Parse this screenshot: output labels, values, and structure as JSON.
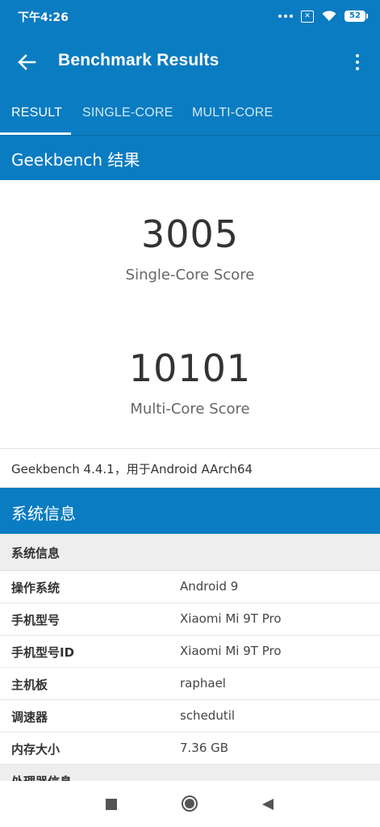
{
  "status_bar": {
    "time": "下午4:26",
    "sim_label": "✕",
    "battery": "52"
  },
  "app_bar": {
    "title": "Benchmark Results",
    "back_icon": "arrow-back-icon",
    "more_icon": "more-vert-icon"
  },
  "tabs": [
    {
      "label": "RESULT",
      "active": true
    },
    {
      "label": "SINGLE-CORE",
      "active": false
    },
    {
      "label": "MULTI-CORE",
      "active": false
    }
  ],
  "result_section": {
    "title": "Geekbench 结果"
  },
  "scores": {
    "single_value": "3005",
    "single_label": "Single-Core Score",
    "multi_value": "10101",
    "multi_label": "Multi-Core Score"
  },
  "version_line": "Geekbench 4.4.1，用于Android AArch64",
  "system_section": {
    "title": "系统信息",
    "subheader": "系统信息",
    "rows": [
      {
        "key": "操作系统",
        "value": "Android 9"
      },
      {
        "key": "手机型号",
        "value": "Xiaomi Mi 9T Pro"
      },
      {
        "key": "手机型号ID",
        "value": "Xiaomi Mi 9T Pro"
      },
      {
        "key": "主机板",
        "value": "raphael"
      },
      {
        "key": "调速器",
        "value": "schedutil"
      },
      {
        "key": "内存大小",
        "value": "7.36 GB"
      }
    ],
    "next_subheader": "处理器信息"
  },
  "colors": {
    "primary": "#0a7cc2",
    "background": "#ffffff",
    "subheader_bg": "#eeeeee"
  }
}
